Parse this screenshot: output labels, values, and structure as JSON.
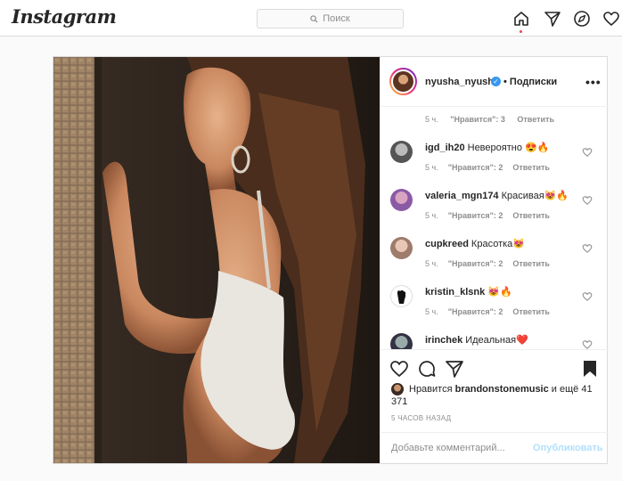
{
  "header": {
    "logo": "Instagram",
    "search_placeholder": "Поиск"
  },
  "post": {
    "author": {
      "username": "nyusha_nyusha",
      "verified_mark": "✓",
      "follow_label": "• Подписки",
      "more": "•••"
    },
    "first_comment_meta": {
      "time": "5 ч.",
      "likes": "\"Нравится\": 3",
      "reply": "Ответить"
    },
    "comments": [
      {
        "username": "igd_ih20",
        "text": "Невероятно 😍🔥",
        "time": "5 ч.",
        "likes": "\"Нравится\": 2",
        "reply": "Ответить"
      },
      {
        "username": "valeria_mgn174",
        "text": "Красивая😻🔥",
        "time": "5 ч.",
        "likes": "\"Нравится\": 2",
        "reply": "Ответить"
      },
      {
        "username": "cupkreed",
        "text": "Красотка😻",
        "time": "5 ч.",
        "likes": "\"Нравится\": 2",
        "reply": "Ответить"
      },
      {
        "username": "kristin_klsnk",
        "text": "😻🔥",
        "time": "5 ч.",
        "likes": "\"Нравится\": 2",
        "reply": "Ответить"
      },
      {
        "username": "irinchek",
        "text": "Идеальная❤️",
        "time": "",
        "likes": "",
        "reply": ""
      }
    ],
    "likes": {
      "prefix": "Нравится",
      "user": "brandonstonemusic",
      "suffix": "и ещё 41 371"
    },
    "timestamp": "5 ЧАСОВ НАЗАД",
    "add_comment": {
      "placeholder": "Добавьте комментарий...",
      "publish_label": "Опубликовать"
    }
  },
  "icons": [
    "search-icon",
    "home-icon",
    "direct-icon",
    "explore-icon",
    "heart-icon",
    "comment-icon",
    "share-icon",
    "bookmark-icon"
  ],
  "colors": {
    "accent": "#3897f0",
    "publish_disabled": "#b2dffc",
    "notification_dot": "#ed4956"
  }
}
